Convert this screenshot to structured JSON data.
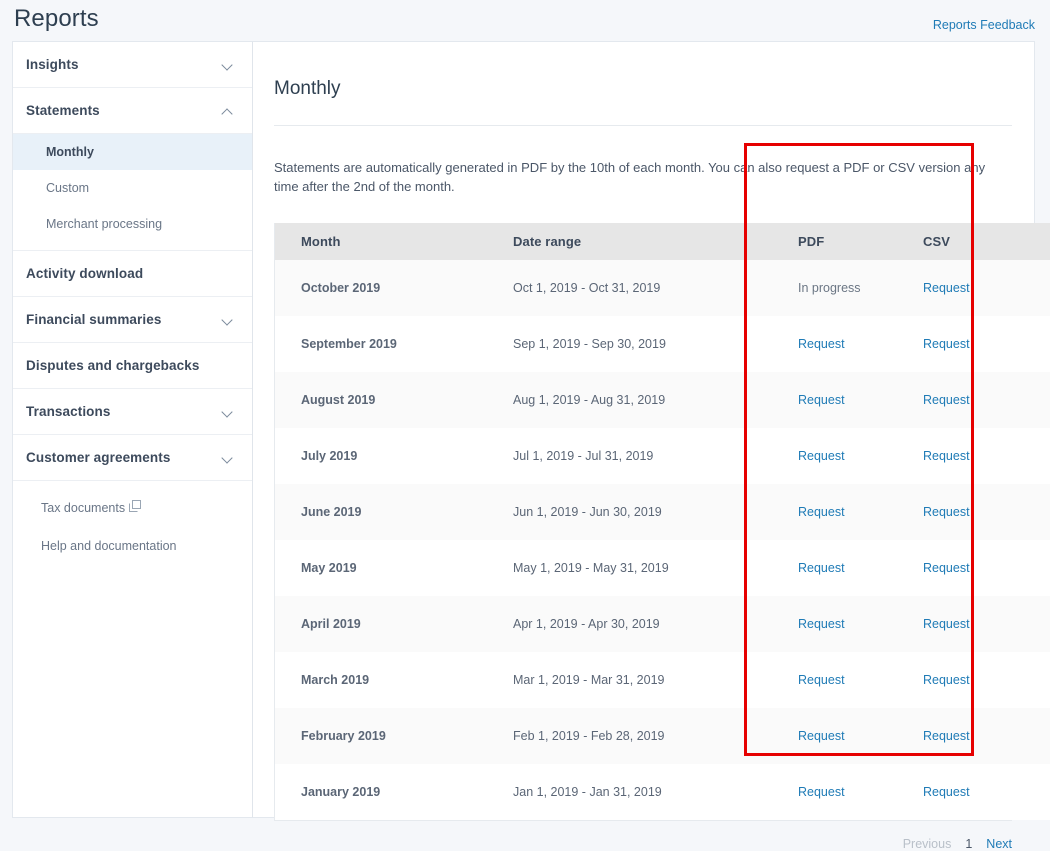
{
  "header": {
    "title": "Reports",
    "feedback_label": "Reports Feedback"
  },
  "sidebar": {
    "groups": [
      {
        "label": "Insights",
        "chevron": "chevron-down-icon",
        "expanded": false
      },
      {
        "label": "Statements",
        "chevron": "chevron-up-icon",
        "expanded": true
      },
      {
        "label": "Activity download",
        "chevron": "",
        "expanded": false
      },
      {
        "label": "Financial summaries",
        "chevron": "chevron-down-icon",
        "expanded": false
      },
      {
        "label": "Disputes and chargebacks",
        "chevron": "",
        "expanded": false
      },
      {
        "label": "Transactions",
        "chevron": "chevron-down-icon",
        "expanded": false
      },
      {
        "label": "Customer agreements",
        "chevron": "chevron-down-icon",
        "expanded": false
      }
    ],
    "statements_subitems": [
      {
        "label": "Monthly",
        "active": true
      },
      {
        "label": "Custom",
        "active": false
      },
      {
        "label": "Merchant processing",
        "active": false
      }
    ],
    "footer_links": [
      {
        "label": "Tax documents",
        "icon": "external-link-icon"
      },
      {
        "label": "Help and documentation",
        "icon": ""
      }
    ]
  },
  "main": {
    "title": "Monthly",
    "intro": "Statements are automatically generated in PDF by the 10th of each month. You can also request a PDF or CSV version any time after the 2nd of the month.",
    "table": {
      "columns": [
        "Month",
        "Date range",
        "PDF",
        "CSV",
        ""
      ],
      "rows": [
        {
          "month": "October 2019",
          "range": "Oct 1, 2019 - Oct 31, 2019",
          "pdf": "In progress",
          "pdf_is_link": false,
          "csv": "Request",
          "csv_is_link": true
        },
        {
          "month": "September 2019",
          "range": "Sep 1, 2019 - Sep 30, 2019",
          "pdf": "Request",
          "pdf_is_link": true,
          "csv": "Request",
          "csv_is_link": true
        },
        {
          "month": "August 2019",
          "range": "Aug 1, 2019 - Aug 31, 2019",
          "pdf": "Request",
          "pdf_is_link": true,
          "csv": "Request",
          "csv_is_link": true
        },
        {
          "month": "July 2019",
          "range": "Jul 1, 2019 - Jul 31, 2019",
          "pdf": "Request",
          "pdf_is_link": true,
          "csv": "Request",
          "csv_is_link": true
        },
        {
          "month": "June 2019",
          "range": "Jun 1, 2019 - Jun 30, 2019",
          "pdf": "Request",
          "pdf_is_link": true,
          "csv": "Request",
          "csv_is_link": true
        },
        {
          "month": "May 2019",
          "range": "May 1, 2019 - May 31, 2019",
          "pdf": "Request",
          "pdf_is_link": true,
          "csv": "Request",
          "csv_is_link": true
        },
        {
          "month": "April 2019",
          "range": "Apr 1, 2019 - Apr 30, 2019",
          "pdf": "Request",
          "pdf_is_link": true,
          "csv": "Request",
          "csv_is_link": true
        },
        {
          "month": "March 2019",
          "range": "Mar 1, 2019 - Mar 31, 2019",
          "pdf": "Request",
          "pdf_is_link": true,
          "csv": "Request",
          "csv_is_link": true
        },
        {
          "month": "February 2019",
          "range": "Feb 1, 2019 - Feb 28, 2019",
          "pdf": "Request",
          "pdf_is_link": true,
          "csv": "Request",
          "csv_is_link": true
        },
        {
          "month": "January 2019",
          "range": "Jan 1, 2019 - Jan 31, 2019",
          "pdf": "Request",
          "pdf_is_link": true,
          "csv": "Request",
          "csv_is_link": true
        }
      ]
    },
    "pagination": {
      "previous_label": "Previous",
      "previous_enabled": false,
      "current_page": "1",
      "next_label": "Next",
      "next_enabled": true
    }
  },
  "annotation": {
    "shape": "rectangle",
    "color": "#e60000",
    "covers": "PDF and CSV request columns"
  },
  "colors": {
    "page_background": "#f5f7fa",
    "panel_background": "#ffffff",
    "link": "#1f7bb6",
    "table_header": "#e6e6e6",
    "row_stripe": "#fafafa",
    "active_nav": "#e8f1f9",
    "annotation": "#e60000"
  }
}
